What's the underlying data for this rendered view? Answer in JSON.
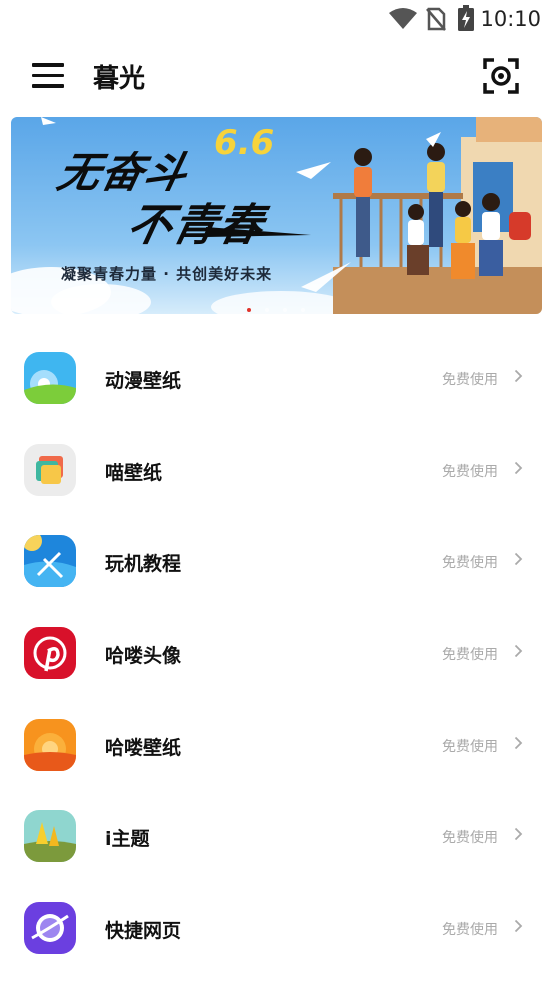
{
  "status_bar": {
    "time": "10:10"
  },
  "appbar": {
    "title": "暮光"
  },
  "banner": {
    "slogan_line1": "无奋斗",
    "slogan_line2": "不青春",
    "date_mark": "6.6",
    "subtitle": "凝聚青春力量 · 共创美好未来"
  },
  "items": [
    {
      "name": "动漫壁纸",
      "action": "免费使用",
      "icon": "sky-landscape-icon"
    },
    {
      "name": "喵壁纸",
      "action": "免费使用",
      "icon": "stacked-cards-icon"
    },
    {
      "name": "玩机教程",
      "action": "免费使用",
      "icon": "app-tools-icon"
    },
    {
      "name": "哈喽头像",
      "action": "免费使用",
      "icon": "pinterest-icon"
    },
    {
      "name": "哈喽壁纸",
      "action": "免费使用",
      "icon": "sunset-icon"
    },
    {
      "name": "i主题",
      "action": "免费使用",
      "icon": "trees-landscape-icon"
    },
    {
      "name": "快捷网页",
      "action": "免费使用",
      "icon": "planet-browser-icon"
    }
  ],
  "colors": {
    "accent_dot": "#e0332b",
    "secondary_text": "#aaaaaa"
  }
}
